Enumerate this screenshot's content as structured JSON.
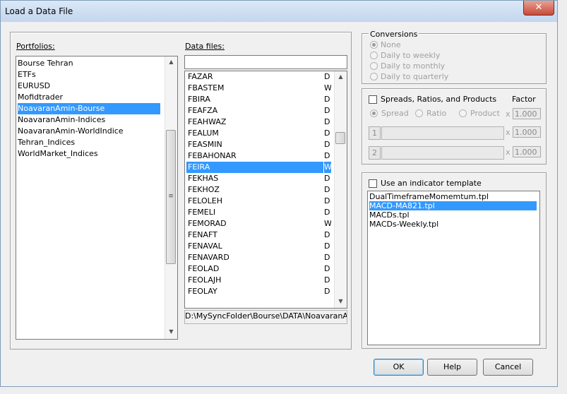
{
  "window": {
    "title": "Load a Data File",
    "close_label": "✕"
  },
  "portfolios": {
    "label": "Portfolios:",
    "items": [
      "Bourse Tehran",
      "ETFs",
      "EURUSD",
      "Mofidtrader",
      "NoavaranAmin-Bourse",
      "NoavaranAmin-Indices",
      "NoavaranAmin-WorldIndice",
      "Tehran_Indices",
      "WorldMarket_Indices"
    ],
    "selected_index": 4
  },
  "data_files": {
    "label": "Data files:",
    "search_value": "",
    "items": [
      {
        "name": "FAZAR",
        "type": "D"
      },
      {
        "name": "FBASTEM",
        "type": "W"
      },
      {
        "name": "FBIRA",
        "type": "D"
      },
      {
        "name": "FEAFZA",
        "type": "D"
      },
      {
        "name": "FEAHWAZ",
        "type": "D"
      },
      {
        "name": "FEALUM",
        "type": "D"
      },
      {
        "name": "FEASMIN",
        "type": "D"
      },
      {
        "name": "FEBAHONAR",
        "type": "D"
      },
      {
        "name": "FEIRA",
        "type": "W"
      },
      {
        "name": "FEKHAS",
        "type": "D"
      },
      {
        "name": "FEKHOZ",
        "type": "D"
      },
      {
        "name": "FELOLEH",
        "type": "D"
      },
      {
        "name": "FEMELI",
        "type": "D"
      },
      {
        "name": "FEMORAD",
        "type": "W"
      },
      {
        "name": "FENAFT",
        "type": "D"
      },
      {
        "name": "FENAVAL",
        "type": "D"
      },
      {
        "name": "FENAVARD",
        "type": "D"
      },
      {
        "name": "FEOLAD",
        "type": "D"
      },
      {
        "name": "FEOLAJH",
        "type": "D"
      },
      {
        "name": "FEOLAY",
        "type": "D"
      }
    ],
    "selected_index": 8,
    "path": "D:\\MySyncFolder\\Bourse\\DATA\\NoavaranAmir"
  },
  "conversions": {
    "label": "Conversions",
    "options": [
      "None",
      "Daily to weekly",
      "Daily to monthly",
      "Daily to quarterly"
    ],
    "selected_index": 0
  },
  "spreads": {
    "checkbox_label": "Spreads, Ratios, and Products",
    "factor_label": "Factor",
    "modes": [
      "Spread",
      "Ratio",
      "Product"
    ],
    "selected_mode": 0,
    "rows": [
      {
        "button": "",
        "factor": "1.000"
      },
      {
        "button": "1",
        "factor": "1.000"
      },
      {
        "button": "2",
        "factor": "1.000"
      }
    ],
    "x_symbol": "x"
  },
  "template": {
    "checkbox_label": "Use an indicator template",
    "items": [
      "DualTimeframeMomemtum.tpl",
      "MACD-MA821.tpl",
      "MACDs.tpl",
      "MACDs-Weekly.tpl"
    ],
    "selected_index": 1
  },
  "buttons": {
    "ok": "OK",
    "help": "Help",
    "cancel": "Cancel"
  },
  "icons": {
    "scroll_up": "▲",
    "scroll_down": "▼",
    "grip": "≡"
  }
}
